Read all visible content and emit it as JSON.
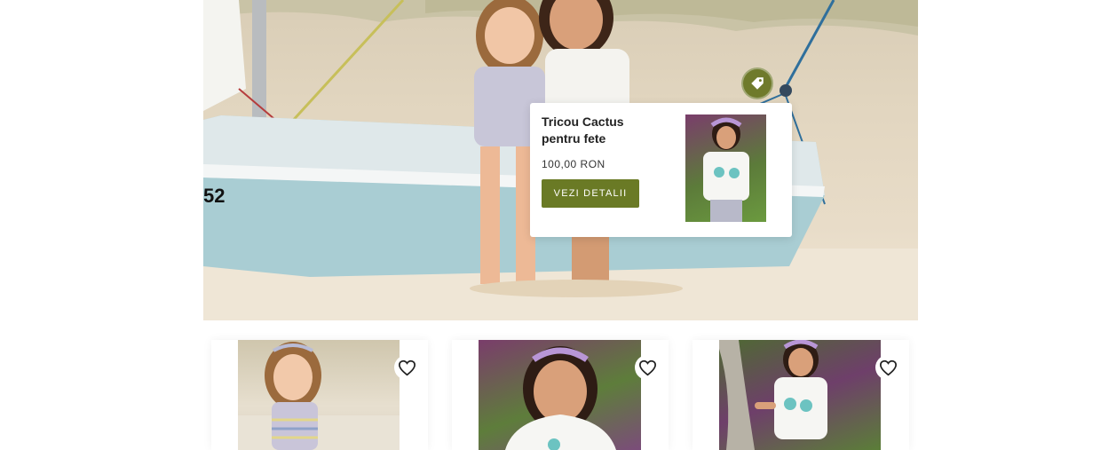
{
  "hero": {
    "hotspot_icon": "tag-icon",
    "card": {
      "title": "Tricou Cactus pentru fete",
      "price": "100,00 RON",
      "button_label": "VEZI DETALII"
    }
  },
  "products": [
    {
      "wishlist_icon": "heart-icon"
    },
    {
      "wishlist_icon": "heart-icon"
    },
    {
      "wishlist_icon": "heart-icon"
    }
  ],
  "colors": {
    "accent": "#6a7a25",
    "hotspot": "#6f7a2b",
    "sand": "#e2d6c0"
  }
}
